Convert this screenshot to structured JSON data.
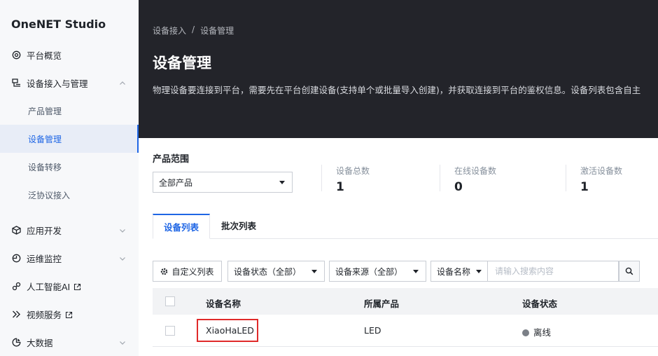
{
  "sidebar": {
    "brand": "OneNET Studio",
    "items": [
      {
        "label": "平台概览",
        "icon": "platform-overview-icon"
      },
      {
        "label": "设备接入与管理",
        "icon": "device-access-icon",
        "expanded": true
      },
      {
        "label": "应用开发",
        "icon": "app-dev-icon"
      },
      {
        "label": "运维监控",
        "icon": "monitor-icon"
      },
      {
        "label": "人工智能AI",
        "icon": "ai-icon",
        "external": true
      },
      {
        "label": "视频服务",
        "icon": "video-icon",
        "external": true
      },
      {
        "label": "大数据",
        "icon": "bigdata-icon"
      }
    ],
    "subitems": [
      {
        "label": "产品管理"
      },
      {
        "label": "设备管理",
        "active": true
      },
      {
        "label": "设备转移"
      },
      {
        "label": "泛协议接入"
      }
    ]
  },
  "header": {
    "breadcrumb": [
      "设备接入",
      "/",
      "设备管理"
    ],
    "title": "设备管理",
    "description": "物理设备要连接到平台，需要先在平台创建设备(支持单个或批量导入创建)，并获取连接到平台的鉴权信息。设备列表包含自主"
  },
  "scope": {
    "label": "产品范围",
    "selected": "全部产品"
  },
  "stats": [
    {
      "label": "设备总数",
      "value": "1"
    },
    {
      "label": "在线设备数",
      "value": "0"
    },
    {
      "label": "激活设备数",
      "value": "1"
    }
  ],
  "tabs": [
    {
      "label": "设备列表",
      "active": true
    },
    {
      "label": "批次列表"
    }
  ],
  "toolbar": {
    "custom_list_label": "自定义列表",
    "status_filter": "设备状态（全部）",
    "source_filter": "设备来源（全部）",
    "field_select": "设备名称",
    "search_placeholder": "请输入搜索内容"
  },
  "table": {
    "headers": [
      "设备名称",
      "所属产品",
      "设备状态"
    ],
    "rows": [
      {
        "name": "XiaoHaLED",
        "product": "LED",
        "status": "离线"
      }
    ]
  },
  "colors": {
    "accent": "#1f66e5",
    "header_bg": "#23242a",
    "highlight": "#e02a2a",
    "offline_dot": "#7b8087"
  }
}
